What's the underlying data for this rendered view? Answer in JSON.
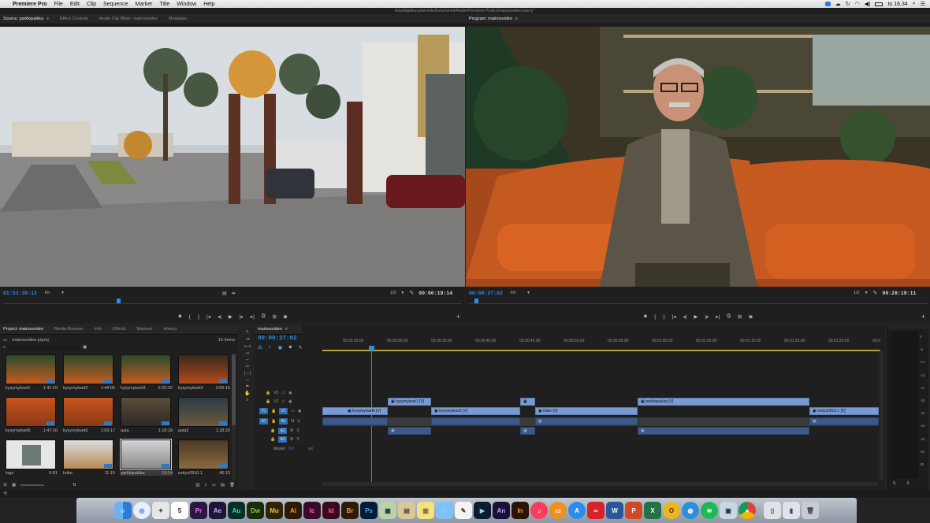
{
  "menubar": {
    "app_name": "Premiere Pro",
    "items": [
      "File",
      "Edit",
      "Clip",
      "Sequence",
      "Marker",
      "Title",
      "Window",
      "Help"
    ],
    "clock": "to 16.34",
    "battery_icon": "battery-icon"
  },
  "window_title": "/Käyttäjät/kuvahelsinki/Dokumentit/Adobe/Premiere Pro/8.0/mainosvideo.prproj *",
  "source": {
    "tabs": [
      "Source: parkkipaikka",
      "Effect Controls",
      "Audio Clip Mixer: mainosvideo",
      "Metadata"
    ],
    "timecode_in": "01:53:39:12",
    "fit": "Fit",
    "ratio": "1/2",
    "timecode_out": "00:00:19:14"
  },
  "program": {
    "tabs": [
      "Program: mainosvideo"
    ],
    "timecode_in": "00:00:27:02",
    "fit": "Fit",
    "ratio": "1/2",
    "timecode_out": "00:28:19:11"
  },
  "project": {
    "tabs": [
      "Project: mainosvideo",
      "Media Browser",
      "Info",
      "Effects",
      "Markers",
      "History"
    ],
    "file_name": "mainosvideo.prproj",
    "item_count": "15 Items",
    "items": [
      {
        "name": "kysymykset1",
        "duration": "1:41:19"
      },
      {
        "name": "kysymykset2",
        "duration": "1:44:00"
      },
      {
        "name": "kysymykset3",
        "duration": "2:23:20"
      },
      {
        "name": "kysymykset4",
        "duration": "3:00:15"
      },
      {
        "name": "kysymykset5",
        "duration": "1:47:16"
      },
      {
        "name": "kysymykset6",
        "duration": "1:09:17"
      },
      {
        "name": "aula",
        "duration": "1:18:18"
      },
      {
        "name": "aula2",
        "duration": "1:28:20"
      },
      {
        "name": "logo",
        "duration": "5:01"
      },
      {
        "name": "foibe",
        "duration": "11:15"
      },
      {
        "name": "parkkipaikka",
        "duration": "19:14"
      },
      {
        "name": "esitys0910.1",
        "duration": "46:19"
      }
    ]
  },
  "timeline": {
    "tab": "mainosvideo",
    "timecode": "00:00:27:02",
    "ruler": [
      "00:00:25:00",
      "00:00:30:00",
      "00:00:35:00",
      "00:00:40:00",
      "00:00:45:00",
      "00:00:50:00",
      "00:00:55:00",
      "00:01:00:00",
      "00:01:05:00",
      "00:01:10:00",
      "00:01:15:00",
      "00:01:20:00",
      "00:0"
    ],
    "tracks": {
      "v3": "V3",
      "v2": "V2",
      "v1": "V1",
      "v1_source": "V1",
      "a1": "A1",
      "a1_source": "A1",
      "a2": "A2",
      "a3": "A3",
      "master": "Master",
      "master_value": "0.0"
    },
    "clips": {
      "v2_1": "kysymykset1 [V]",
      "v2_2": "parkkipaikka [V]",
      "v1_1": "kysymykset6 [V]",
      "v1_2": "kysymykset2 [V]",
      "v1_3": "foibe [V]",
      "v1_4": "esitys0910.1 [V]"
    }
  },
  "meter": {
    "scale": [
      "0",
      "-6",
      "-12",
      "-18",
      "-24",
      "-30",
      "-36",
      "-42",
      "-48",
      "-54",
      "dB"
    ],
    "channels": [
      "S",
      "S"
    ]
  },
  "dock": {
    "icons": [
      "finder-icon",
      "safari-icon",
      "photos-icon",
      "calendar-icon",
      "premiere-icon",
      "after-effects-icon",
      "audition-icon",
      "dreamweaver-icon",
      "muse-icon",
      "illustrator-icon",
      "incopy-icon",
      "indesign-icon",
      "bridge-icon",
      "photoshop-icon",
      "preview-icon",
      "books-icon",
      "notes-icon",
      "messages-icon",
      "textedit-icon",
      "media-encoder-icon",
      "animate-icon",
      "fcp-icon",
      "itunes-icon",
      "ibooks-icon",
      "appstore-icon",
      "creative-cloud-icon",
      "word-icon",
      "powerpoint-icon",
      "excel-icon",
      "outlook-icon",
      "globe-icon",
      "spotify-icon",
      "preview2-icon",
      "chrome-icon",
      "documents-icon",
      "downloads-icon",
      "trash-icon"
    ],
    "calendar_day": "5",
    "labels": {
      "pr": "Pr",
      "ae": "Ae",
      "au": "Au",
      "dw": "Dw",
      "mu": "Mu",
      "ai": "Ai",
      "ic": "Ic",
      "id": "Id",
      "br": "Br",
      "ps": "Ps",
      "an": "An",
      "in": "In"
    }
  }
}
